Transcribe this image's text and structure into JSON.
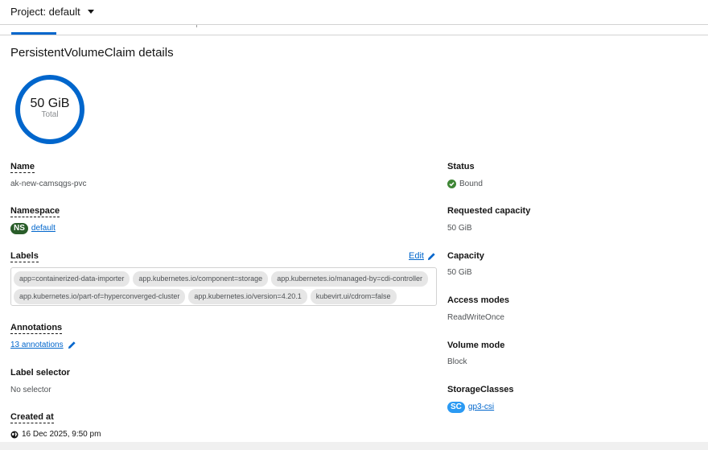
{
  "project": {
    "label": "Project: default"
  },
  "page_title": "PersistentVolumeClaim details",
  "donut": {
    "value": "50 GiB",
    "sub": "Total"
  },
  "left": {
    "name": {
      "label": "Name",
      "value": "ak-new-camsqgs-pvc"
    },
    "namespace": {
      "label": "Namespace",
      "badge": "NS",
      "value": "default"
    },
    "labels": {
      "label": "Labels",
      "edit": "Edit",
      "chips": [
        "app=containerized-data-importer",
        "app.kubernetes.io/component=storage",
        "app.kubernetes.io/managed-by=cdi-controller",
        "app.kubernetes.io/part-of=hyperconverged-cluster",
        "app.kubernetes.io/version=4.20.1",
        "kubevirt.ui/cdrom=false"
      ]
    },
    "annotations": {
      "label": "Annotations",
      "value": "13 annotations"
    },
    "label_selector": {
      "label": "Label selector",
      "value": "No selector"
    },
    "created_at": {
      "label": "Created at",
      "value": "16 Dec 2025, 9:50 pm"
    }
  },
  "right": {
    "status": {
      "label": "Status",
      "value": "Bound"
    },
    "requested": {
      "label": "Requested capacity",
      "value": "50 GiB"
    },
    "capacity": {
      "label": "Capacity",
      "value": "50 GiB"
    },
    "access_modes": {
      "label": "Access modes",
      "value": "ReadWriteOnce"
    },
    "volume_mode": {
      "label": "Volume mode",
      "value": "Block"
    },
    "storage_classes": {
      "label": "StorageClasses",
      "badge": "SC",
      "value": "gp3-csi"
    }
  },
  "colors": {
    "accent": "#0066cc",
    "success": "#3e8635",
    "ns_badge": "#2a5d2a",
    "sc_badge": "#2b9af3"
  }
}
